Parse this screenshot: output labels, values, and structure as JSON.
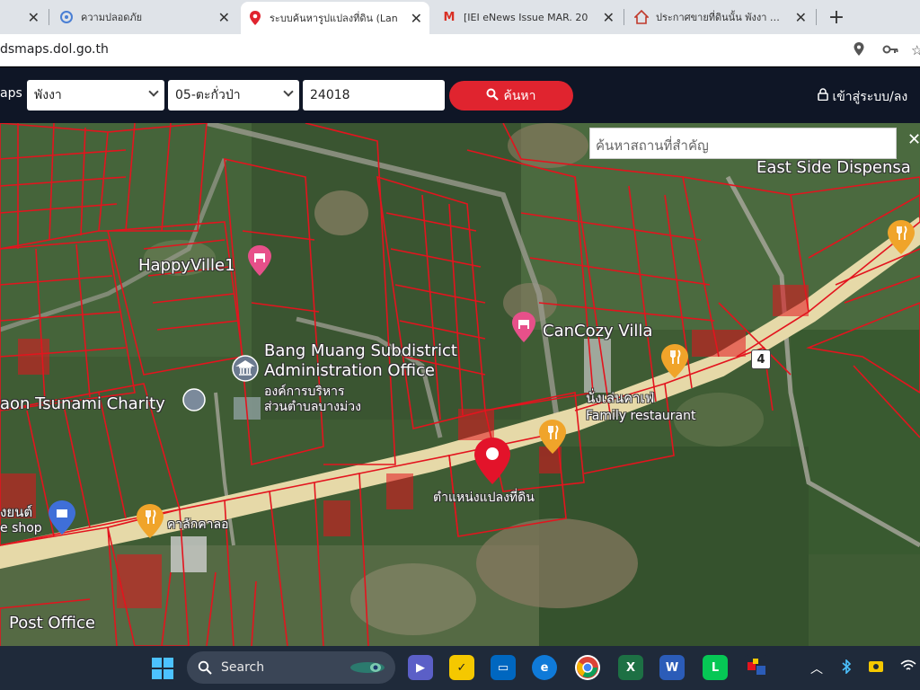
{
  "browser": {
    "tabs": [
      {
        "title": "",
        "favicon": "generic"
      },
      {
        "title": "ความปลอดภัย",
        "favicon": "security"
      },
      {
        "title": "ระบบค้นหารูปแปลงที่ดิน (Lan",
        "favicon": "location-pin"
      },
      {
        "title": "[IEI eNews Issue MAR. 20",
        "favicon": "gmail"
      },
      {
        "title": "ประกาศขายที่ดินนั้น พังงา อำเภ",
        "favicon": "home"
      }
    ],
    "url": "dsmaps.dol.go.th"
  },
  "header": {
    "brand": "aps",
    "province": "พังงา",
    "district": "05-ตะกั่วป่า",
    "parcel_no": "24018",
    "search_label": "ค้นหา",
    "login_label": "เข้าสู่ระบบ/ลง"
  },
  "map": {
    "place_search_placeholder": "ค้นหาสถานที่สำคัญ",
    "labels": {
      "east_side": "East Side Dispensa",
      "happyville": "HappyVille1",
      "cancozy": "CanCozy Villa",
      "bang_muang_1": "Bang Muang Subdistrict",
      "bang_muang_2": "Administration Office",
      "bang_muang_th1": "องค์การบริหาร",
      "bang_muang_th2": "ส่วนตำบลบางม่วง",
      "tsunami": "aon Tsunami Charity",
      "cafe_th": "นั่งเล่นคาเฟ่",
      "family_restaurant": "Family restaurant",
      "parcel_position": "ตำแหน่งแปลงที่ดิน",
      "kalak": "คาลักคาลอ",
      "post_office": "Post Office",
      "left_shop_1": "งยนต์",
      "left_shop_2": "e shop",
      "route": "4"
    }
  },
  "taskbar": {
    "search_label": "Search"
  },
  "colors": {
    "header_bg": "#0f1626",
    "accent_red": "#e0242f",
    "parcel_line": "#e3141e",
    "road": "#e6d9a8"
  }
}
